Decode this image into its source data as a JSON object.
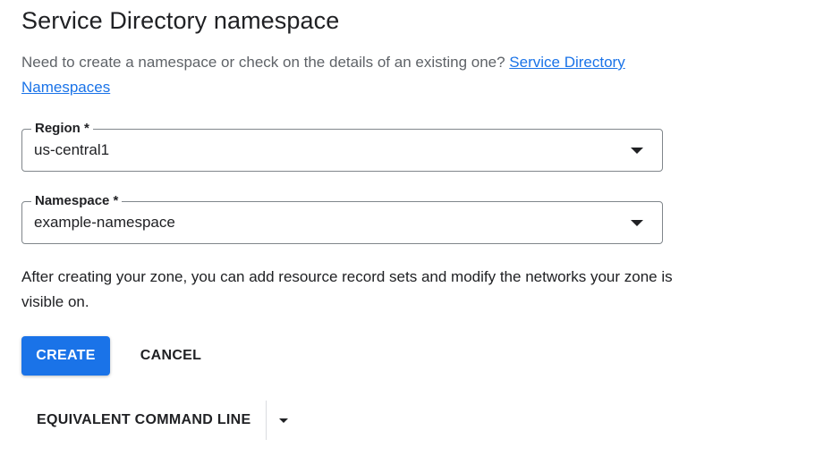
{
  "header": {
    "title": "Service Directory namespace"
  },
  "description": {
    "text": "Need to create a namespace or check on the details of an existing one? ",
    "link_label": "Service Directory Namespaces"
  },
  "form": {
    "region": {
      "label": "Region *",
      "value": "us-central1",
      "icon": "dropdown-arrow-icon"
    },
    "namespace": {
      "label": "Namespace *",
      "value": "example-namespace",
      "icon": "dropdown-arrow-icon"
    }
  },
  "info_text": "After creating your zone, you can add resource record sets and modify the networks your zone is visible on.",
  "actions": {
    "create_label": "CREATE",
    "cancel_label": "CANCEL",
    "equivalent_cmd_label": "EQUIVALENT COMMAND LINE",
    "equivalent_cmd_menu_icon": "caret-down-icon"
  },
  "colors": {
    "primary": "#1a73e8",
    "text": "#202124",
    "secondary_text": "#5f6368",
    "border": "#80868b"
  }
}
